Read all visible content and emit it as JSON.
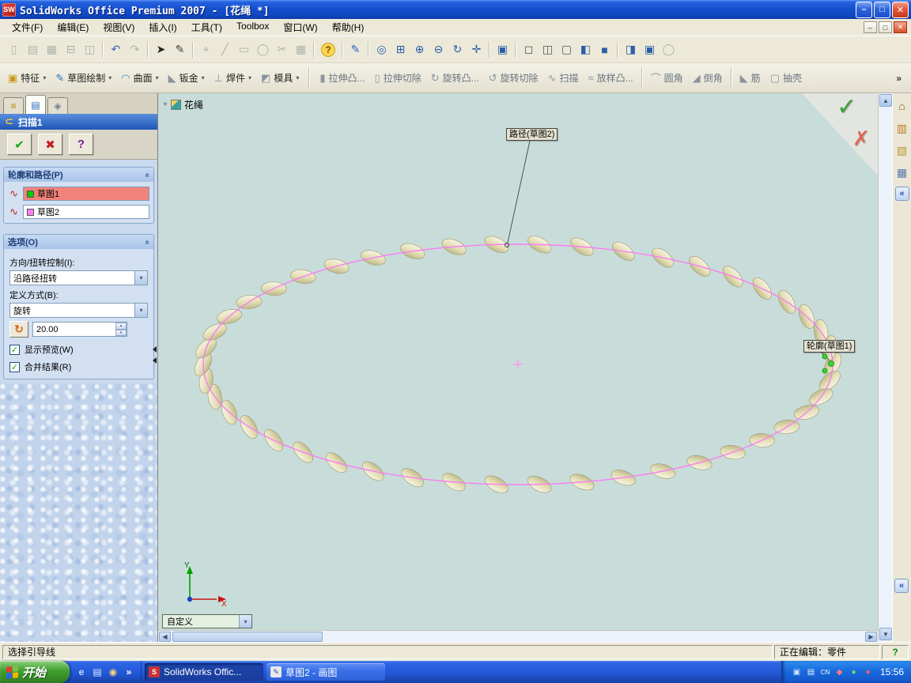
{
  "titlebar": {
    "icon_text": "SW",
    "title": "SolidWorks Office Premium 2007 - [花绳 *]",
    "minimize": "–",
    "restore": "□",
    "close": "✕"
  },
  "menubar": {
    "items": [
      {
        "name": "menu-file",
        "label": "文件(F)"
      },
      {
        "name": "menu-edit",
        "label": "编辑(E)"
      },
      {
        "name": "menu-view",
        "label": "视图(V)"
      },
      {
        "name": "menu-insert",
        "label": "插入(I)"
      },
      {
        "name": "menu-tools",
        "label": "工具(T)"
      },
      {
        "name": "menu-toolbox",
        "label": "Toolbox"
      },
      {
        "name": "menu-window",
        "label": "窗口(W)"
      },
      {
        "name": "menu-help",
        "label": "帮助(H)"
      }
    ],
    "mdi_minimize": "–",
    "mdi_restore": "□",
    "mdi_close": "✕"
  },
  "toolbar": {
    "icons": [
      {
        "name": "new-document-icon",
        "glyph": "▯",
        "dim": true
      },
      {
        "name": "open-icon",
        "glyph": "▤",
        "dim": true
      },
      {
        "name": "save-icon",
        "glyph": "▦",
        "dim": true
      },
      {
        "name": "print-icon",
        "glyph": "⊟",
        "dim": true
      },
      {
        "name": "print-preview-icon",
        "glyph": "◫",
        "dim": true
      },
      {
        "sep": true
      },
      {
        "name": "undo-icon",
        "glyph": "↶",
        "color": "#3A62B8"
      },
      {
        "name": "redo-icon",
        "glyph": "↷",
        "dim": true
      },
      {
        "sep": true
      },
      {
        "name": "select-icon",
        "glyph": "➤",
        "color": "#222222"
      },
      {
        "name": "ink-pen-icon",
        "glyph": "✎",
        "color": "#444444"
      },
      {
        "sep": true
      },
      {
        "name": "smart-dimension-icon",
        "glyph": "⌖",
        "dim": true
      },
      {
        "name": "sketch-line-icon",
        "glyph": "╱",
        "dim": true
      },
      {
        "name": "sketch-rectangle-icon",
        "glyph": "▭",
        "dim": true
      },
      {
        "name": "sketch-circle-icon",
        "glyph": "◯",
        "dim": true
      },
      {
        "name": "trim-entities-icon",
        "glyph": "✂",
        "dim": true
      },
      {
        "name": "grid-settings-icon",
        "glyph": "▦",
        "dim": true
      },
      {
        "sep": true
      },
      {
        "name": "help-icon",
        "glyph": "?",
        "color": "#6A4A00",
        "bg": "#FFD34E"
      },
      {
        "sep": true
      },
      {
        "name": "sketch-icon",
        "glyph": "✎",
        "color": "#2B6CC4"
      },
      {
        "sep": true
      },
      {
        "name": "zoom-to-fit-icon",
        "glyph": "◎",
        "color": "#2B5FA8"
      },
      {
        "name": "zoom-to-area-icon",
        "glyph": "⊞",
        "color": "#2B5FA8"
      },
      {
        "name": "zoom-in-out-icon",
        "glyph": "⊕",
        "color": "#2B5FA8"
      },
      {
        "name": "zoom-to-selection-icon",
        "glyph": "⊖",
        "color": "#2B5FA8"
      },
      {
        "name": "rotate-view-icon",
        "glyph": "↻",
        "color": "#2B5FA8"
      },
      {
        "name": "pan-icon",
        "glyph": "✛",
        "color": "#2B5FA8"
      },
      {
        "sep": true
      },
      {
        "name": "standard-views-icon",
        "glyph": "▣",
        "color": "#2B5FA8"
      },
      {
        "sep": true
      },
      {
        "name": "wireframe-icon",
        "glyph": "◻",
        "color": "#50585F"
      },
      {
        "name": "hidden-lines-visible-icon",
        "glyph": "◫",
        "color": "#50585F"
      },
      {
        "name": "hidden-lines-removed-icon",
        "glyph": "▢",
        "color": "#50585F"
      },
      {
        "name": "shaded-with-edges-icon",
        "glyph": "◧",
        "color": "#2B5FA8"
      },
      {
        "name": "shaded-icon",
        "glyph": "■",
        "color": "#2B5FA8"
      },
      {
        "sep": true
      },
      {
        "name": "section-view-icon",
        "glyph": "◨",
        "color": "#2B5FA8"
      },
      {
        "name": "realview-icon",
        "glyph": "▣",
        "color": "#2B5FA8"
      },
      {
        "name": "display-settings-icon",
        "glyph": "◯",
        "dim": true
      }
    ]
  },
  "commandbar": {
    "tabs": [
      {
        "name": "features-tab",
        "icon_name": "features-tab-icon",
        "label": "特征",
        "glyph": "▣",
        "color": "#C79810"
      },
      {
        "name": "sketch-tab",
        "icon_name": "sketch-tab-icon",
        "label": "草图绘制",
        "glyph": "✎",
        "color": "#2B6CC4"
      },
      {
        "name": "surfaces-tab",
        "icon_name": "surfaces-tab-icon",
        "label": "曲面",
        "glyph": "◠",
        "color": "#3A8FB0"
      },
      {
        "name": "sheet-metal-tab",
        "icon_name": "sheet-metal-tab-icon",
        "label": "钣金",
        "glyph": "◣",
        "color": "#8A94A0"
      },
      {
        "name": "weldments-tab",
        "icon_name": "weldments-tab-icon",
        "label": "焊件",
        "glyph": "⊥",
        "color": "#8A94A0"
      },
      {
        "name": "mold-tools-tab",
        "icon_name": "mold-tools-tab-icon",
        "label": "模具",
        "glyph": "◩",
        "color": "#8A94A0"
      }
    ],
    "buttons": [
      {
        "name": "extruded-boss-button",
        "icon_name": "extruded-boss-icon",
        "label": "拉伸凸...",
        "glyph": "▮"
      },
      {
        "name": "extruded-cut-button",
        "icon_name": "extruded-cut-icon",
        "label": "拉伸切除",
        "glyph": "▯"
      },
      {
        "name": "revolved-boss-button",
        "icon_name": "revolved-boss-icon",
        "label": "旋转凸...",
        "glyph": "↻"
      },
      {
        "name": "revolved-cut-button",
        "icon_name": "revolved-cut-icon",
        "label": "旋转切除",
        "glyph": "↺"
      },
      {
        "name": "sweep-button",
        "icon_name": "sweep-icon",
        "label": "扫描",
        "glyph": "∿"
      },
      {
        "name": "loft-button",
        "icon_name": "loft-icon",
        "label": "放样凸...",
        "glyph": "≈"
      },
      {
        "sep": true
      },
      {
        "name": "fillet-button",
        "icon_name": "fillet-icon",
        "label": "圆角",
        "glyph": "⌒"
      },
      {
        "name": "chamfer-button",
        "icon_name": "chamfer-icon",
        "label": "倒角",
        "glyph": "◢"
      },
      {
        "sep": true
      },
      {
        "name": "rib-button",
        "icon_name": "rib-icon",
        "label": "筋",
        "glyph": "◣"
      },
      {
        "name": "shell-button",
        "icon_name": "shell-icon",
        "label": "抽壳",
        "glyph": "▢"
      }
    ],
    "overflow": "»"
  },
  "property_manager": {
    "tabs": [
      {
        "name": "featuremanager-tab",
        "glyph": "≡",
        "color": "#B8860B",
        "active": false
      },
      {
        "name": "propertymanager-tab",
        "glyph": "▤",
        "color": "#2A6AC0",
        "active": true
      },
      {
        "name": "configurationmanager-tab",
        "glyph": "◈",
        "color": "#708090",
        "active": false
      }
    ],
    "title": "扫描1",
    "title_icon": "⊂",
    "ok_glyph": "✔",
    "cancel_glyph": "✖",
    "help_glyph": "?",
    "chevron_glyph": "«",
    "combo_arrow": "▾",
    "spin_up": "▴",
    "spin_down": "▾",
    "selection_icon": "∿",
    "profile_path_group": {
      "title": "轮廓和路径(P)",
      "profile_value": "草图1",
      "path_value": "草图2",
      "profile_swatch": "#00CC00",
      "path_swatch": "#FF7DF5"
    },
    "options_group": {
      "title": "选项(O)",
      "orientation_label": "方向/扭转控制(I):",
      "orientation_value": "沿路径扭转",
      "define_label": "定义方式(B):",
      "define_value": "旋转",
      "rotate_icon": "↻",
      "twist_value": "20.00",
      "preview_label": "显示预览(W)",
      "merge_label": "合并结果(R)",
      "check_glyph": "✓"
    }
  },
  "viewport": {
    "doc_label": "花绳",
    "tree_expand": "+",
    "path_callout": "路径(草图2)",
    "profile_callout": "轮廓(草图1)",
    "triad": {
      "x": "X",
      "y": "Y"
    },
    "view_combo_value": "自定义",
    "combo_arrow": "▾",
    "confirm_ok": "✓",
    "confirm_cancel": "✗",
    "background_color": "#C8DDD9",
    "rope_color": "#E3DDB4",
    "path_color": "#FA7DF2"
  },
  "taskpane": {
    "icons": [
      {
        "name": "solidworks-resources-icon",
        "glyph": "⌂",
        "color": "#8A5A1E"
      },
      {
        "name": "design-library-icon",
        "glyph": "▥",
        "color": "#C07820"
      },
      {
        "name": "file-explorer-icon",
        "glyph": "▧",
        "color": "#B89A30"
      },
      {
        "name": "view-palette-icon",
        "glyph": "▦",
        "color": "#5878B0"
      }
    ],
    "chevron": "«"
  },
  "scrollbars": {
    "up": "▲",
    "down": "▼",
    "left": "◀",
    "right": "▶"
  },
  "statusbar": {
    "left": "选择引导线",
    "editing": "正在编辑：零件",
    "help": "?"
  },
  "taskbar": {
    "start_label": "开始",
    "start_flag_colors": [
      "#E23B2E",
      "#7BC043",
      "#2E66D8",
      "#F4B400"
    ],
    "quick_launch": [
      {
        "name": "internet-explorer-icon",
        "glyph": "e",
        "color": "#BFE0FF"
      },
      {
        "name": "show-desktop-icon",
        "glyph": "▤",
        "color": "#D8E8FF"
      },
      {
        "name": "media-player-icon",
        "glyph": "◉",
        "color": "#FFD27A"
      },
      {
        "name": "quick-launch-overflow-icon",
        "glyph": "»",
        "color": "#FFFFFF"
      }
    ],
    "tasks": [
      {
        "name": "taskbar-task-solidworks",
        "label": "SolidWorks Offic...",
        "active": true,
        "icon": {
          "name": "solidworks-task-icon",
          "glyph": "S",
          "bg": "#C83232",
          "fg": "#FFFFFF"
        }
      },
      {
        "name": "taskbar-task-paint",
        "label": "草图2 - 画图",
        "active": false,
        "icon": {
          "name": "paint-task-icon",
          "glyph": "✎",
          "bg": "#E8E8E8",
          "fg": "#3050A0"
        }
      }
    ],
    "tray_icons": [
      {
        "name": "tray-monitor-icon",
        "glyph": "▣",
        "color": "#CFE4FF"
      },
      {
        "name": "tray-ime-icon",
        "glyph": "▤",
        "color": "#E8F0FF"
      },
      {
        "name": "tray-language-icon",
        "glyph": "CN",
        "color": "#FFFFFF"
      },
      {
        "name": "tray-solidworks-icon",
        "glyph": "◆",
        "color": "#FF7A7A"
      },
      {
        "name": "tray-safety-icon",
        "glyph": "●",
        "color": "#72E072"
      },
      {
        "name": "tray-alert-icon",
        "glyph": "●",
        "color": "#FF6060"
      }
    ],
    "time": "15:56"
  }
}
